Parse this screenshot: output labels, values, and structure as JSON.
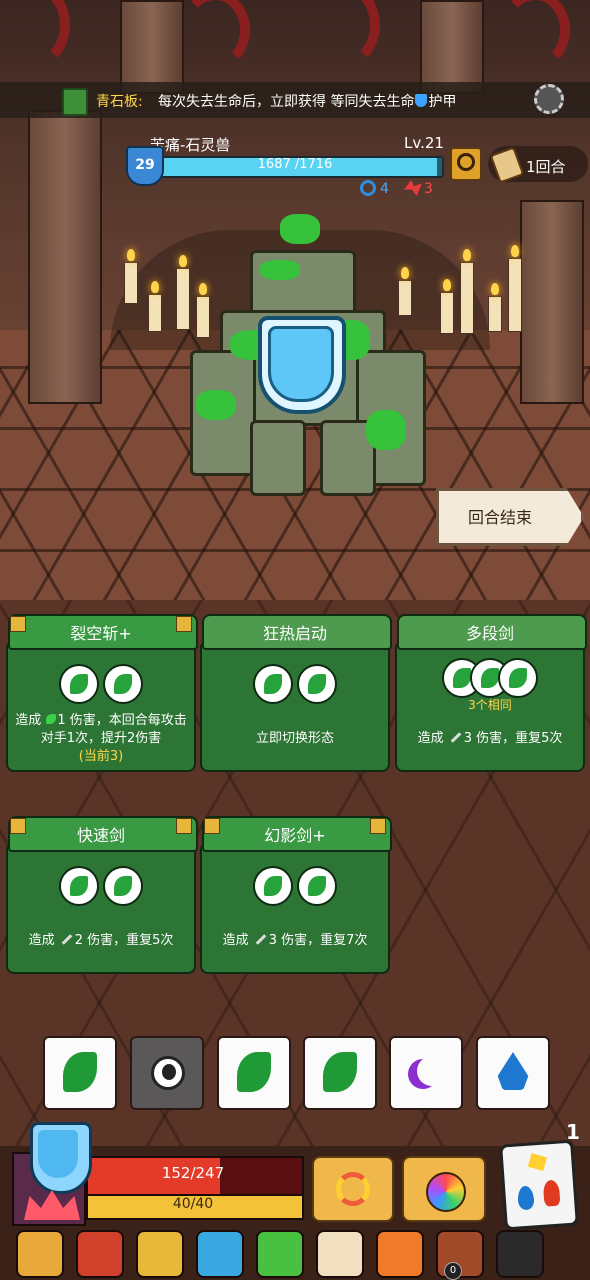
{
  "tip": {
    "title": "青石板:",
    "text_before": "每次失去生命后，立即获得 等同失去生命",
    "text_after": "护甲"
  },
  "enemy": {
    "name": "苦痛-石灵兽",
    "level": "Lv.21",
    "armor": "29",
    "hp_text": "1687 /1716",
    "hp_current": 1687,
    "hp_max": 1716,
    "focus": "4",
    "strength": "3"
  },
  "round": {
    "label": "1回合"
  },
  "end_turn": {
    "label": "回合结束"
  },
  "cards": [
    {
      "title": "裂空斩+",
      "slots": 2,
      "note": "",
      "desc_pre": "造成",
      "desc_val": "1",
      "desc_post": "伤害，本回合每攻击对手1次，提升2伤害",
      "desc_hl": "(当前3)"
    },
    {
      "title": "狂热启动",
      "slots": 2,
      "note": "",
      "desc": "立即切换形态"
    },
    {
      "title": "多段剑",
      "slots": 3,
      "note": "3个相同",
      "desc_pre": "造成",
      "desc_val": "3",
      "desc_post": "伤害，重复5次"
    },
    {
      "title": "快速剑",
      "slots": 2,
      "note": "",
      "desc_pre": "造成",
      "desc_val": "2",
      "desc_post": "伤害，重复5次"
    },
    {
      "title": "幻影剑+",
      "slots": 2,
      "note": "",
      "desc_pre": "造成",
      "desc_val": "3",
      "desc_post": "伤害，重复7次"
    }
  ],
  "dice": [
    {
      "icon": "leaf-icon",
      "face": "leaf"
    },
    {
      "icon": "eye-icon",
      "face": "eye",
      "selected": true
    },
    {
      "icon": "leaf-icon",
      "face": "leaf"
    },
    {
      "icon": "leaf-icon",
      "face": "leaf"
    },
    {
      "icon": "moon-icon",
      "face": "moon"
    },
    {
      "icon": "water-drop-icon",
      "face": "drop"
    }
  ],
  "player": {
    "hp_text": "152/247",
    "hp_current": 152,
    "hp_max": 247,
    "energy_text": "40/40",
    "energy_current": 40,
    "energy_max": 40,
    "dice_count": "1"
  },
  "relics": [
    {
      "icon": "golden-hand-icon",
      "color": "#e8a83a"
    },
    {
      "icon": "red-horn-icon",
      "color": "#d0402a"
    },
    {
      "icon": "golden-claw-icon",
      "color": "#e8b83a"
    },
    {
      "icon": "blue-crystal-icon",
      "color": "#3aa8e0"
    },
    {
      "icon": "green-potion-icon",
      "color": "#4ac040"
    },
    {
      "icon": "ring-orb-icon",
      "color": "#f0e0c0"
    },
    {
      "icon": "fire-crown-icon",
      "color": "#f07a2a"
    },
    {
      "icon": "meat-plate-icon",
      "color": "#a04a2a",
      "count": "0"
    },
    {
      "icon": "magic-hat-icon",
      "color": "#2a2a2a"
    }
  ]
}
